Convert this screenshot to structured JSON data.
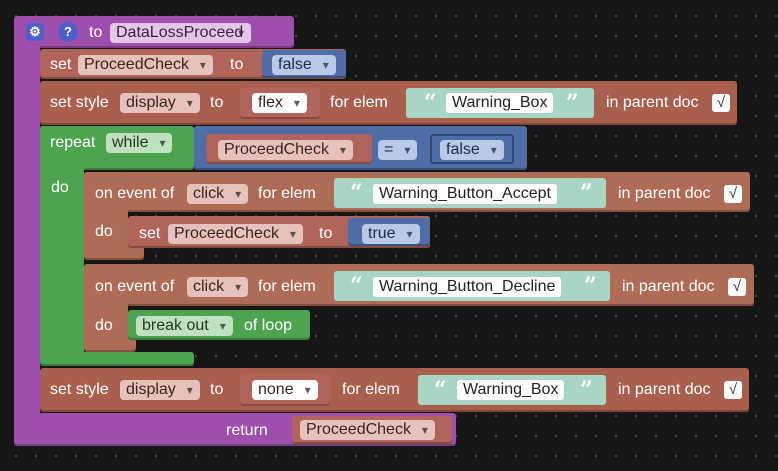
{
  "procedure": {
    "prefix": "to",
    "name": "DataLossProceed",
    "return_label": "return",
    "return_var": "ProceedCheck"
  },
  "icons": {
    "gear": "gear-icon",
    "help": "help-icon"
  },
  "set1": {
    "label": "set",
    "var": "ProceedCheck",
    "to": "to",
    "value": "false"
  },
  "style1": {
    "label": "set style",
    "property": "display",
    "to": "to",
    "value": "flex",
    "for_elem": "for elem",
    "elem": "Warning_Box",
    "in_parent": "in parent doc"
  },
  "repeat": {
    "label": "repeat",
    "mode": "while",
    "do": "do",
    "cond_var": "ProceedCheck",
    "op": "=",
    "cond_value": "false"
  },
  "event1": {
    "label": "on event of",
    "event": "click",
    "for_elem": "for elem",
    "elem": "Warning_Button_Accept",
    "in_parent": "in parent doc",
    "do": "do",
    "set_label": "set",
    "set_var": "ProceedCheck",
    "set_to": "to",
    "set_value": "true"
  },
  "event2": {
    "label": "on event of",
    "event": "click",
    "for_elem": "for elem",
    "elem": "Warning_Button_Decline",
    "in_parent": "in parent doc",
    "do": "do",
    "flow": "break out",
    "flow_suffix": "of loop"
  },
  "style2": {
    "label": "set style",
    "property": "display",
    "to": "to",
    "value": "none",
    "for_elem": "for elem",
    "elem": "Warning_Box",
    "in_parent": "in parent doc"
  },
  "checkmark": "√",
  "quote_open": "“",
  "quote_close": "”",
  "colors": {
    "procedure": "#9e4fae",
    "variable": "#b0645a",
    "loop": "#4da350",
    "logic": "#4f6ea8",
    "text": "#a9d5c4",
    "style": "#a85f4e"
  }
}
